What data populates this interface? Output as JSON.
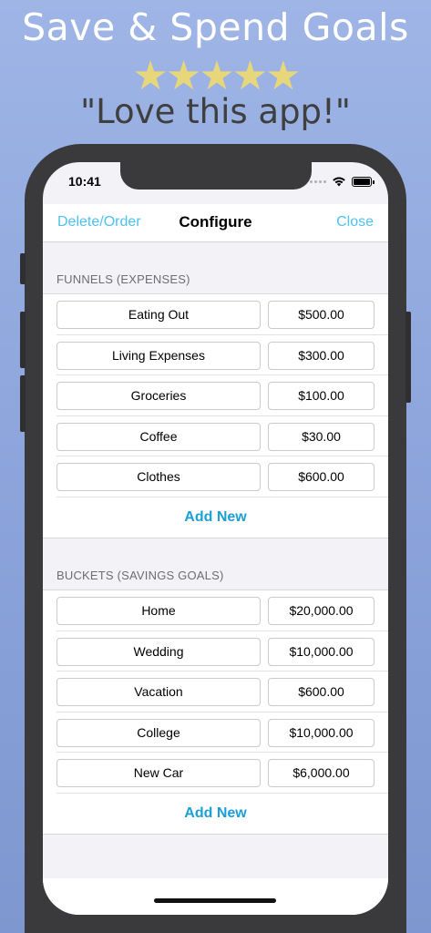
{
  "banner": {
    "headline": "Save & Spend Goals",
    "stars": "★★★★★",
    "quote": "\"Love this app!\""
  },
  "status_bar": {
    "time": "10:41"
  },
  "navbar": {
    "left_label": "Delete/Order",
    "title": "Configure",
    "right_label": "Close"
  },
  "funnels": {
    "header": "FUNNELS (EXPENSES)",
    "items": [
      {
        "name": "Eating Out",
        "amount": "$500.00"
      },
      {
        "name": "Living Expenses",
        "amount": "$300.00"
      },
      {
        "name": "Groceries",
        "amount": "$100.00"
      },
      {
        "name": "Coffee",
        "amount": "$30.00"
      },
      {
        "name": "Clothes",
        "amount": "$600.00"
      }
    ],
    "add_label": "Add New"
  },
  "buckets": {
    "header": "BUCKETS (SAVINGS GOALS)",
    "items": [
      {
        "name": "Home",
        "amount": "$20,000.00"
      },
      {
        "name": "Wedding",
        "amount": "$10,000.00"
      },
      {
        "name": "Vacation",
        "amount": "$600.00"
      },
      {
        "name": "College",
        "amount": "$10,000.00"
      },
      {
        "name": "New Car",
        "amount": "$6,000.00"
      }
    ],
    "add_label": "Add New"
  },
  "colors": {
    "accent": "#4fc1f2",
    "add_button": "#1a9fd6",
    "star": "#e8d77a"
  }
}
